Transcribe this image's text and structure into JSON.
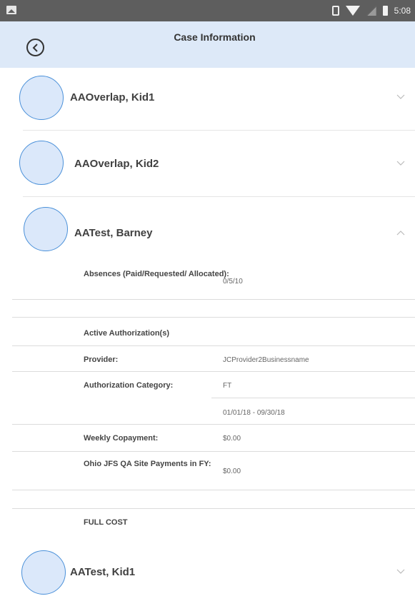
{
  "status_bar": {
    "time": "5:08"
  },
  "header": {
    "title": "Case Information"
  },
  "children": [
    {
      "name": "AAOverlap, Kid1",
      "expanded": false
    },
    {
      "name": "AAOverlap, Kid2",
      "expanded": false
    },
    {
      "name": "AATest, Barney",
      "expanded": true
    },
    {
      "name": "AATest, Kid1",
      "expanded": false
    }
  ],
  "details": {
    "absences_label": "Absences (Paid/Requested/ Allocated):",
    "absences_value": "0/5/10",
    "active_authorizations": "Active Authorization(s)",
    "provider_label": "Provider:",
    "provider_value": "JCProvider2Businessname",
    "auth_category_label": "Authorization Category:",
    "auth_category_value": "FT",
    "date_range": "01/01/18 - 09/30/18",
    "weekly_copay_label": "Weekly Copayment:",
    "weekly_copay_value": "$0.00",
    "site_payments_label": "Ohio JFS QA Site Payments in FY:",
    "site_payments_value": "$0.00",
    "full_cost": "FULL COST"
  }
}
